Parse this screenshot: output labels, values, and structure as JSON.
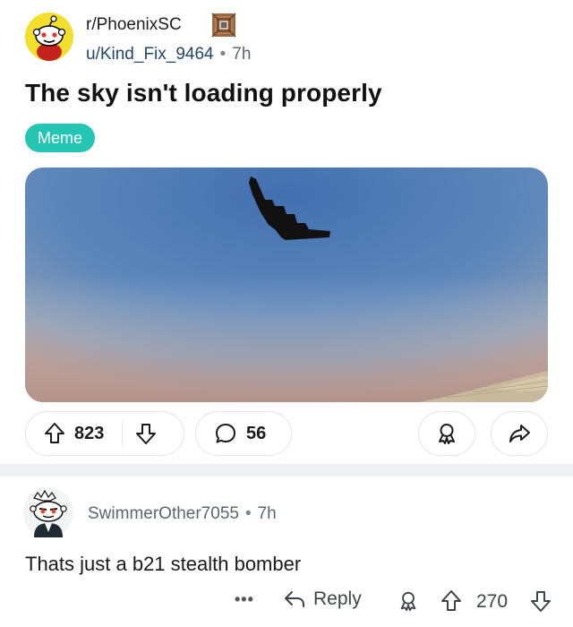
{
  "post": {
    "subreddit": "r/PhoenixSC",
    "author": "u/Kind_Fix_9464",
    "separator": "•",
    "time": "7h",
    "title": "The sky isn't loading properly",
    "flair": "Meme",
    "flair_color": "#24c5b3",
    "upvotes": "823",
    "comments": "56",
    "icons": [
      "snoo-avatar-icon",
      "command-block-icon",
      "upvote-icon",
      "downvote-icon",
      "comment-icon",
      "award-icon",
      "share-icon"
    ]
  },
  "comment": {
    "author": "SwimmerOther7055",
    "separator": "•",
    "time": "7h",
    "body": "Thats just a b21 stealth bomber",
    "more": "•••",
    "reply_label": "Reply",
    "score": "270",
    "icons": [
      "reply-arrow-icon",
      "award-icon",
      "upvote-icon",
      "downvote-icon"
    ]
  },
  "colors": {
    "accent_teal": "#24c5b3",
    "sky_top": "#4d7bb4",
    "sky_horizon": "#b9978f",
    "divider": "#eef0f2"
  }
}
